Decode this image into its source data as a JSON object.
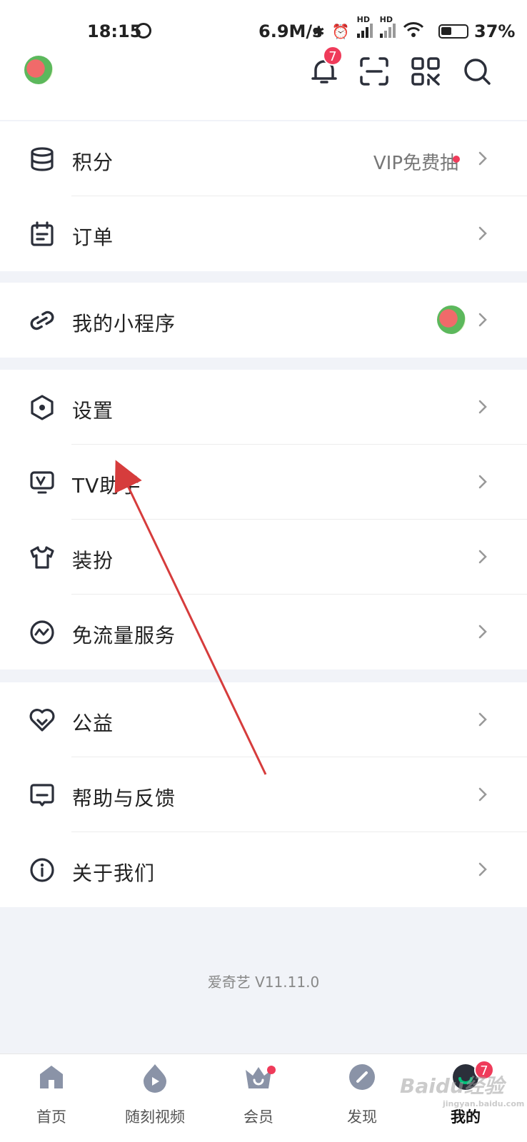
{
  "status_bar": {
    "time": "18:15",
    "speed": "6.9M/s",
    "hd1": "HD",
    "hd2": "HD",
    "battery": "37%"
  },
  "header": {
    "notification_count": "7"
  },
  "groups": [
    [
      {
        "label": "积分",
        "extra": "VIP免费抽",
        "icon": "coins-icon"
      },
      {
        "label": "订单",
        "icon": "order-icon"
      }
    ],
    [
      {
        "label": "我的小程序",
        "icon": "mini-program-icon"
      }
    ],
    [
      {
        "label": "设置",
        "icon": "settings-icon"
      },
      {
        "label": "TV助手",
        "icon": "tv-icon"
      },
      {
        "label": "装扮",
        "icon": "shirt-icon"
      },
      {
        "label": "免流量服务",
        "icon": "data-free-icon"
      }
    ],
    [
      {
        "label": "公益",
        "icon": "heart-icon"
      },
      {
        "label": "帮助与反馈",
        "icon": "feedback-icon"
      },
      {
        "label": "关于我们",
        "icon": "info-icon"
      }
    ]
  ],
  "version": "爱奇艺 V11.11.0",
  "tabs": [
    {
      "label": "首页",
      "icon": "home-icon"
    },
    {
      "label": "随刻视频",
      "icon": "flame-play-icon"
    },
    {
      "label": "会员",
      "icon": "crown-icon"
    },
    {
      "label": "发现",
      "icon": "compass-icon"
    },
    {
      "label": "我的",
      "icon": "profile-icon",
      "badge": "7"
    }
  ],
  "watermark": {
    "text": "Baidu经验",
    "sub": "jingyan.baidu.com"
  },
  "colors": {
    "accent_red": "#ef3b5a",
    "annotation_arrow": "#d63c3c",
    "icon_dark": "#2b2f3a",
    "tab_icon": "#8a93a7"
  }
}
